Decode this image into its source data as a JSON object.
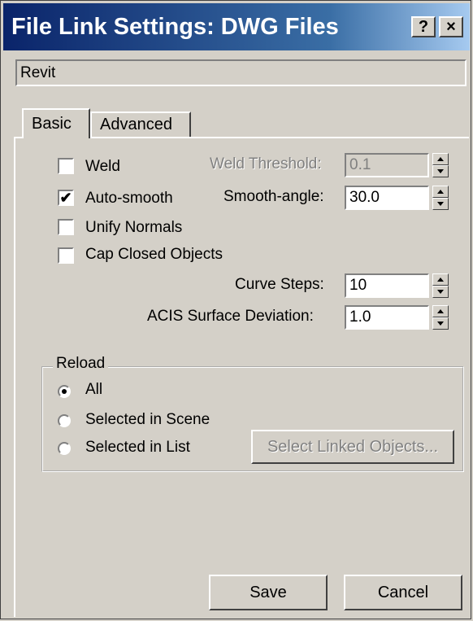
{
  "window": {
    "title": "File Link Settings: DWG Files",
    "help_button": "?",
    "close_button": "×"
  },
  "path_field": {
    "value": "Revit"
  },
  "tabs": [
    {
      "label": "Basic",
      "active": true
    },
    {
      "label": "Advanced",
      "active": false
    }
  ],
  "basic": {
    "weld": {
      "label": "Weld",
      "checked": false
    },
    "auto_smooth": {
      "label": "Auto-smooth",
      "checked": true
    },
    "unify_normals": {
      "label": "Unify Normals",
      "checked": false
    },
    "cap_closed_objects": {
      "label": "Cap Closed Objects",
      "checked": false
    },
    "weld_threshold": {
      "label": "Weld Threshold:",
      "value": "0.1",
      "enabled": false
    },
    "smooth_angle": {
      "label": "Smooth-angle:",
      "value": "30.0"
    },
    "curve_steps": {
      "label": "Curve Steps:",
      "value": "10"
    },
    "acis_surface_deviation": {
      "label": "ACIS Surface Deviation:",
      "value": "1.0"
    }
  },
  "reload": {
    "label": "Reload",
    "options": [
      {
        "label": "All",
        "checked": true
      },
      {
        "label": "Selected in Scene",
        "checked": false
      },
      {
        "label": "Selected in List",
        "checked": false
      }
    ],
    "select_linked_button": "Select Linked Objects..."
  },
  "footer": {
    "save_label": "Save",
    "cancel_label": "Cancel"
  },
  "colors": {
    "dialog_bg": "#d4d0c8",
    "title_gradient_start": "#0a246a",
    "title_gradient_end": "#a6caf0"
  }
}
